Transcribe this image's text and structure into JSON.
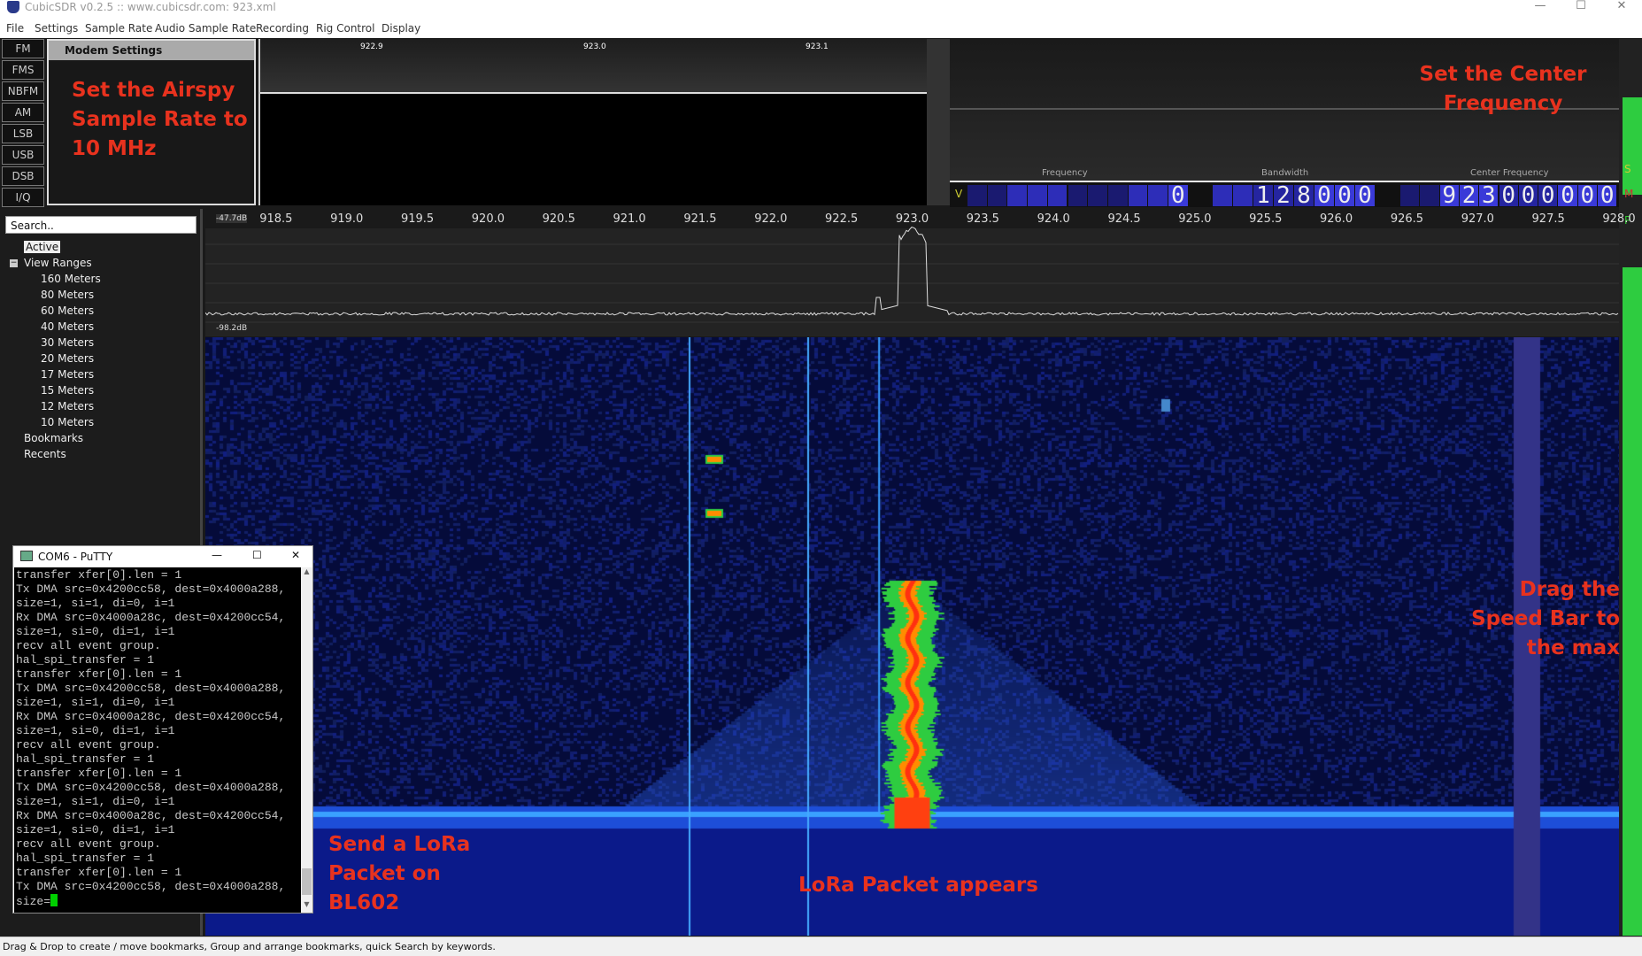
{
  "window": {
    "title": "CubicSDR v0.2.5 :: www.cubicsdr.com: 923.xml",
    "minimize": "—",
    "maximize": "☐",
    "close": "✕"
  },
  "menu": [
    "File",
    "Settings",
    "Sample Rate",
    "Audio Sample Rate",
    "Recording",
    "Rig Control",
    "Display"
  ],
  "modes": [
    "FM",
    "FMS",
    "NBFM",
    "AM",
    "LSB",
    "USB",
    "DSB",
    "I/Q"
  ],
  "modem": {
    "title": "Modem Settings"
  },
  "scope": {
    "ticks": [
      "922.9",
      "923.0",
      "923.1"
    ]
  },
  "freq_panel": {
    "labels": {
      "frequency": "Frequency",
      "bandwidth": "Bandwidth",
      "center": "Center  Frequency"
    },
    "v_label": "V",
    "frequency": "0",
    "bandwidth": "128000",
    "center_frequency": "923000000"
  },
  "meters": {
    "s": "S",
    "m": "M",
    "p": "P",
    "accent": "#2ecc40"
  },
  "sidebar": {
    "search_placeholder": "Search..",
    "tree": [
      {
        "label": "Active",
        "level": 0,
        "selected": true
      },
      {
        "label": "View Ranges",
        "level": 0,
        "expanded": true
      },
      {
        "label": "160 Meters",
        "level": 1
      },
      {
        "label": "80 Meters",
        "level": 1
      },
      {
        "label": "60 Meters",
        "level": 1
      },
      {
        "label": "40 Meters",
        "level": 1
      },
      {
        "label": "30 Meters",
        "level": 1
      },
      {
        "label": "20 Meters",
        "level": 1
      },
      {
        "label": "17 Meters",
        "level": 1
      },
      {
        "label": "15 Meters",
        "level": 1
      },
      {
        "label": "12 Meters",
        "level": 1
      },
      {
        "label": "10 Meters",
        "level": 1
      },
      {
        "label": "Bookmarks",
        "level": 0
      },
      {
        "label": "Recents",
        "level": 0
      }
    ]
  },
  "spectrum": {
    "db_top": "-47.7dB",
    "db_bottom": "-98.2dB",
    "range_mhz": [
      918.0,
      928.0
    ],
    "ticks": [
      "918.5",
      "919.0",
      "919.5",
      "920.0",
      "920.5",
      "921.0",
      "921.5",
      "922.0",
      "922.5",
      "923.0",
      "923.5",
      "924.0",
      "924.5",
      "925.0",
      "925.5",
      "926.0",
      "926.5",
      "927.0",
      "927.5",
      "928.0"
    ]
  },
  "putty": {
    "title": "COM6 - PuTTY",
    "lines": [
      "transfer xfer[0].len = 1",
      "Tx DMA src=0x4200cc58, dest=0x4000a288,",
      "size=1, si=1, di=0, i=1",
      "Rx DMA src=0x4000a28c, dest=0x4200cc54,",
      "size=1, si=0, di=1, i=1",
      "recv all event group.",
      "hal_spi_transfer = 1",
      "transfer xfer[0].len = 1",
      "Tx DMA src=0x4200cc58, dest=0x4000a288,",
      "size=1, si=1, di=0, i=1",
      "Rx DMA src=0x4000a28c, dest=0x4200cc54,",
      "size=1, si=0, di=1, i=1",
      "recv all event group.",
      "hal_spi_transfer = 1",
      "transfer xfer[0].len = 1",
      "Tx DMA src=0x4200cc58, dest=0x4000a288,",
      "size=1, si=1, di=0, i=1",
      "Rx DMA src=0x4000a28c, dest=0x4200cc54,",
      "size=1, si=0, di=1, i=1",
      "recv all event group.",
      "hal_spi_transfer = 1",
      "transfer xfer[0].len = 1",
      "Tx DMA src=0x4200cc58, dest=0x4000a288,"
    ],
    "prompt": "size="
  },
  "annotations": {
    "sample_rate": "Set the Airspy Sample Rate to 10 MHz",
    "center": "Set the Center Frequency",
    "speed": "Drag the Speed Bar to the max",
    "send": "Send a LoRa Packet on BL602",
    "appears": "LoRa Packet appears",
    "color": "#e8321e"
  },
  "status": "Drag & Drop to create / move bookmarks, Group and arrange bookmarks, quick Search by keywords."
}
